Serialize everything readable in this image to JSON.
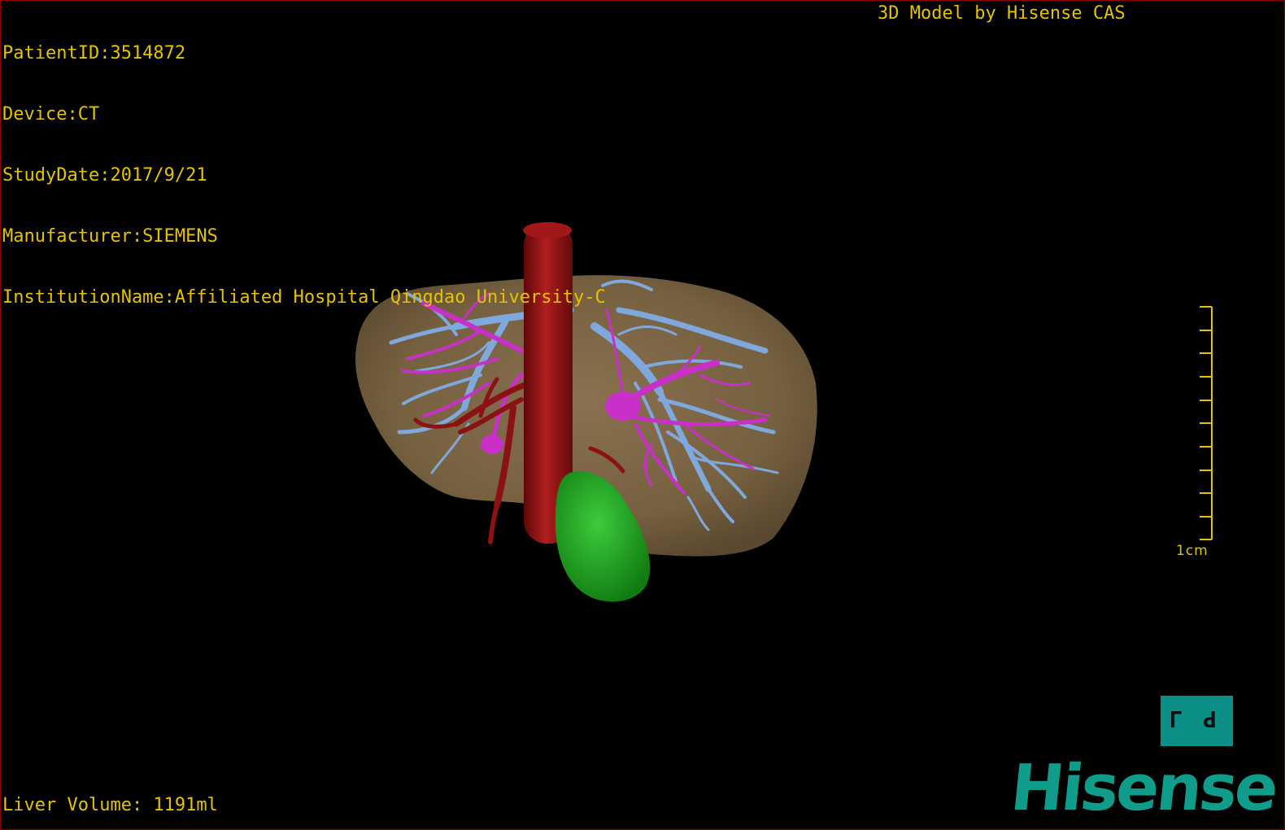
{
  "info": {
    "patient_id": "PatientID:3514872",
    "device": "Device:CT",
    "study_date": "StudyDate:2017/9/21",
    "manufacturer": "Manufacturer:SIEMENS",
    "institution": "InstitutionName:Affiliated Hospital Qingdao University-C"
  },
  "model_credit": "3D Model by Hisense CAS",
  "liver_volume": "Liver Volume: 1191ml",
  "scale_bar": {
    "label": "1cm"
  },
  "orientation_cube": {
    "left_glyph": "L",
    "right_glyph": "P"
  },
  "brand": "Hisense",
  "colors": {
    "overlay_text": "#e6c200",
    "liver": "#7a6446",
    "artery": "#9c1414",
    "portal_vein": "#7fa8dc",
    "hepatic_vein": "#c830c8",
    "gallbladder": "#1ea51e",
    "brand": "#0f9c8b"
  }
}
